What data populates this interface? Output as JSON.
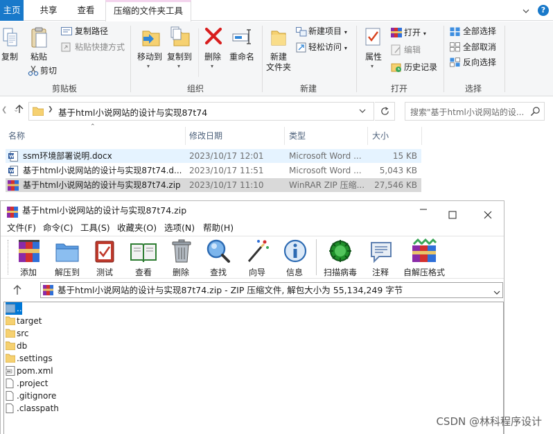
{
  "ribbon": {
    "tabs": [
      "主页",
      "共享",
      "查看",
      "压缩的文件夹工具"
    ],
    "groups": {
      "clipboard": {
        "label": "剪贴板",
        "copy": "复制",
        "paste": "粘贴",
        "copy_path": "复制路径",
        "paste_shortcut": "粘贴快捷方式",
        "cut": "剪切"
      },
      "organize": {
        "label": "组织",
        "move_to": "移动到",
        "copy_to": "复制到",
        "delete": "删除",
        "rename": "重命名"
      },
      "new": {
        "label": "新建",
        "new_folder_line1": "新建",
        "new_folder_line2": "文件夹",
        "new_item": "新建项目",
        "easy_access": "轻松访问"
      },
      "open": {
        "label": "打开",
        "properties": "属性",
        "open": "打开",
        "edit": "编辑",
        "history": "历史记录"
      },
      "select": {
        "label": "选择",
        "select_all": "全部选择",
        "select_none": "全部取消",
        "invert": "反向选择"
      }
    }
  },
  "address": {
    "path": "基于html小说网站的设计与实现87t74",
    "search_placeholder": "搜索\"基于html小说网站的设..."
  },
  "file_list": {
    "columns": [
      "名称",
      "修改日期",
      "类型",
      "大小"
    ],
    "rows": [
      {
        "name": "ssm环境部署说明.docx",
        "date": "2023/10/17 12:01",
        "type": "Microsoft Word ...",
        "size": "15 KB",
        "icon": "word-doc-icon"
      },
      {
        "name": "基于html小说网站的设计与实现87t74.d...",
        "date": "2023/10/17 11:51",
        "type": "Microsoft Word ...",
        "size": "5,043 KB",
        "icon": "word-doc-icon"
      },
      {
        "name": "基于html小说网站的设计与实现87t74.zip",
        "date": "2023/10/17 11:10",
        "type": "WinRAR ZIP 压缩...",
        "size": "27,546 KB",
        "icon": "winrar-archive-icon"
      }
    ]
  },
  "winrar": {
    "title": "基于html小说网站的设计与实现87t74.zip",
    "menu": [
      "文件(F)",
      "命令(C)",
      "工具(S)",
      "收藏夹(O)",
      "选项(N)",
      "帮助(H)"
    ],
    "toolbar": [
      "添加",
      "解压到",
      "测试",
      "查看",
      "删除",
      "查找",
      "向导",
      "信息",
      "扫描病毒",
      "注释",
      "自解压格式"
    ],
    "path": "基于html小说网站的设计与实现87t74.zip - ZIP 压缩文件, 解包大小为 55,134,249 字节",
    "items": [
      {
        "name": "..",
        "icon": "up-folder-icon"
      },
      {
        "name": "target",
        "icon": "folder-icon"
      },
      {
        "name": "src",
        "icon": "folder-icon"
      },
      {
        "name": "db",
        "icon": "folder-icon"
      },
      {
        "name": ".settings",
        "icon": "folder-icon"
      },
      {
        "name": "pom.xml",
        "icon": "xml-file-icon"
      },
      {
        "name": ".project",
        "icon": "file-icon"
      },
      {
        "name": ".gitignore",
        "icon": "file-icon"
      },
      {
        "name": ".classpath",
        "icon": "file-icon"
      }
    ]
  },
  "watermark": "CSDN @林科程序设计",
  "colors": {
    "accent": "#1979ca",
    "selected_row": "#cce8ff",
    "hover_row": "#e5f3ff",
    "zip_row": "#d9d9d9"
  }
}
